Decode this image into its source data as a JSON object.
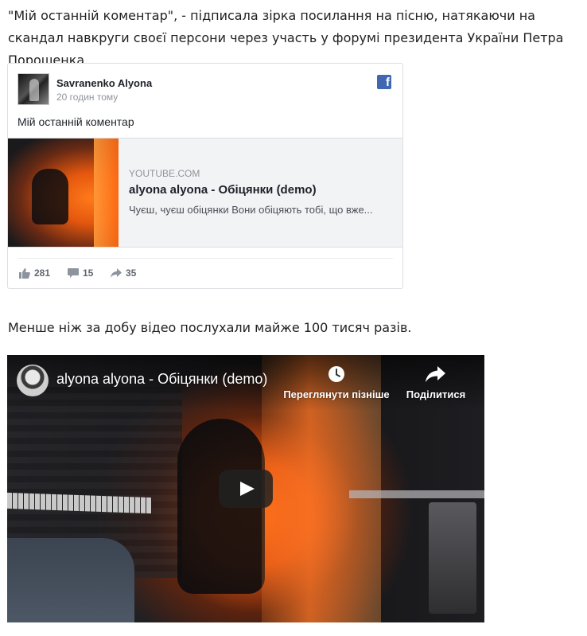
{
  "article": {
    "paragraph1": "\"Мій останній коментар\", - підписала зірка посилання на пісню, натякаючи на скандал навкруги своєї персони через участь у форумі президента України Петра Порошенка.",
    "paragraph2": "Менше ніж за добу відео послухали майже 100 тисяч разів."
  },
  "fb_post": {
    "author": "Savranenko Alyona",
    "time": "20 годин тому",
    "text": "Мій останній коментар",
    "logo_icon": "facebook-icon",
    "link": {
      "source": "YOUTUBE.COM",
      "title": "alyona alyona - Обіцянки (demo)",
      "description": "Чуєш, чуєш обіцянки Вони обіцяють тобі, що вже..."
    },
    "stats": {
      "likes": "281",
      "comments": "15",
      "shares": "35"
    },
    "colors": {
      "facebook_blue": "#4267b2",
      "muted_text": "#90949c"
    }
  },
  "youtube_embed": {
    "title": "alyona alyona - Обіцянки (demo)",
    "watch_later_label": "Переглянути пізніше",
    "share_label": "Поділитися",
    "icons": [
      "clock-icon",
      "share-arrow-icon",
      "play-icon"
    ],
    "colors": {
      "play_button": "#212121"
    }
  }
}
